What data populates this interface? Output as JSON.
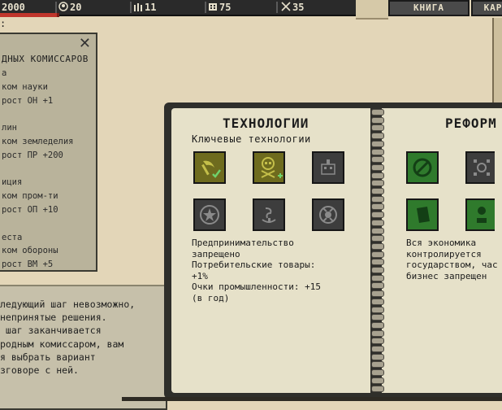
{
  "topbar": {
    "money": "2000",
    "settlers": "20",
    "workers": "11",
    "factories": "75",
    "military": "35",
    "book_btn": "КНИГА",
    "map_btn": "КАР"
  },
  "commissars_panel": {
    "title": "ДНЫХ КОМИССАРОВ",
    "lines": [
      "а",
      "ком науки",
      "рост ОН +1",
      "",
      "лин",
      "ком земледелия",
      "рост ПР +200",
      "",
      "иция",
      "ком пром-ти",
      "рост ОП +10",
      "",
      "еста",
      "ком обороны",
      "рост ВМ +5"
    ],
    "top_char": ":"
  },
  "dialog": {
    "lines": [
      "ледующий шаг невозможно,",
      "непринятые решения.",
      " шаг заканчивается",
      "родным комиссаром, вам",
      "я выбрать вариант",
      "зговоре с ней."
    ]
  },
  "book": {
    "left_title": "ТЕХНОЛОГИИ",
    "left_subtitle": "Ключевые технологии",
    "right_title": "РЕФОРМ",
    "tech_tiles": [
      {
        "icon": "hammer-sickle-check-icon",
        "state": "active"
      },
      {
        "icon": "skull-plus-icon",
        "state": "active"
      },
      {
        "icon": "factory-machine-icon",
        "state": "normal"
      },
      {
        "icon": "star-emblem-icon",
        "state": "normal"
      },
      {
        "icon": "ship-wheel-icon",
        "state": "normal"
      },
      {
        "icon": "atom-emblem-icon",
        "state": "normal"
      }
    ],
    "reform_tiles": [
      {
        "icon": "ban-icon",
        "state": "green"
      },
      {
        "icon": "gear-network-icon",
        "state": "normal"
      },
      {
        "icon": "document-icon",
        "state": "green"
      },
      {
        "icon": "money-person-icon",
        "state": "green"
      }
    ],
    "left_desc": [
      "Предпринимательство",
      "запрещено",
      "Потребительские товары:",
      "+1%",
      "Очки промышленности: +15",
      "(в год)"
    ],
    "right_desc": [
      "Вся экономика",
      "контролируется",
      "государством, час",
      "бизнес запрещен"
    ]
  },
  "colors": {
    "tile_active": "#6e6b1e",
    "tile_green": "#2f7a2c",
    "tile_normal": "#474747",
    "icon_active": "#c4bf4a",
    "icon_green_dark": "#133f15"
  }
}
